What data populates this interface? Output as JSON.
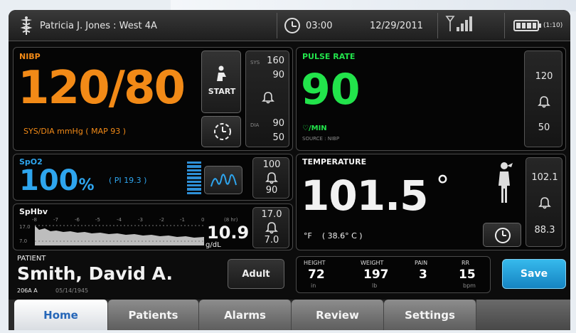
{
  "header": {
    "patient_location": "Patricia J. Jones : West 4A",
    "timer": "03:00",
    "date": "12/29/2011",
    "battery_time": "(1:10)"
  },
  "nibp": {
    "label": "NIBP",
    "value": "120/80",
    "units": "SYS/DIA mmHg ( MAP 93 )",
    "start_label": "START",
    "sys_tag": "SYS",
    "sys_high": "160",
    "sys_low": "90",
    "dia_tag": "DIA",
    "dia_high": "90",
    "dia_low": "50"
  },
  "pulse": {
    "label": "PULSE RATE",
    "value": "90",
    "units": "♡/MIN",
    "source": "SOURCE : NIBP",
    "high": "120",
    "low": "50"
  },
  "spo2": {
    "label": "SpO2",
    "value": "100",
    "unit": "%",
    "pi": "( PI 19.3 )",
    "high": "100",
    "low": "90"
  },
  "sphb": {
    "label": "SpHbv",
    "value": "10.9",
    "unit": "g/dL",
    "axis_ticks": [
      "-8",
      "-7",
      "-6",
      "-5",
      "-4",
      "-3",
      "-2",
      "-1",
      "0"
    ],
    "axis_unit": "(8 hr)",
    "y_high": "17.0",
    "y_low": "7.0",
    "high": "17.0",
    "low": "7.0"
  },
  "temperature": {
    "label": "TEMPERATURE",
    "value": "101.5",
    "degree": "°",
    "units": "°F    ( 38.6° C )",
    "high": "102.1",
    "low": "88.3"
  },
  "patient": {
    "label": "PATIENT",
    "name": "Smith, David  A.",
    "room": "206A A",
    "dob": "05/14/1945",
    "type_button": "Adult"
  },
  "manual": {
    "items": [
      {
        "label": "HEIGHT",
        "value": "72",
        "unit": "in"
      },
      {
        "label": "WEIGHT",
        "value": "197",
        "unit": "lb"
      },
      {
        "label": "PAIN",
        "value": "3",
        "unit": ""
      },
      {
        "label": "RR",
        "value": "15",
        "unit": "bpm"
      }
    ],
    "save_label": "Save"
  },
  "tabs": {
    "home": "Home",
    "patients": "Patients",
    "alarms": "Alarms",
    "review": "Review",
    "settings": "Settings"
  },
  "colors": {
    "nibp": "#f28a17",
    "pulse": "#22e34b",
    "spo2": "#2ea5ee",
    "save": "#1aa3dc",
    "active_tab_text": "#2566b8"
  },
  "icons": {
    "header": [
      "caduceus-icon",
      "clock-icon",
      "signal-icon",
      "battery-icon"
    ],
    "panels": [
      "bell-icon",
      "person-start-icon",
      "interval-timer-icon",
      "waveform-icon",
      "patient-standing-icon",
      "thermometer-timer-icon"
    ]
  }
}
